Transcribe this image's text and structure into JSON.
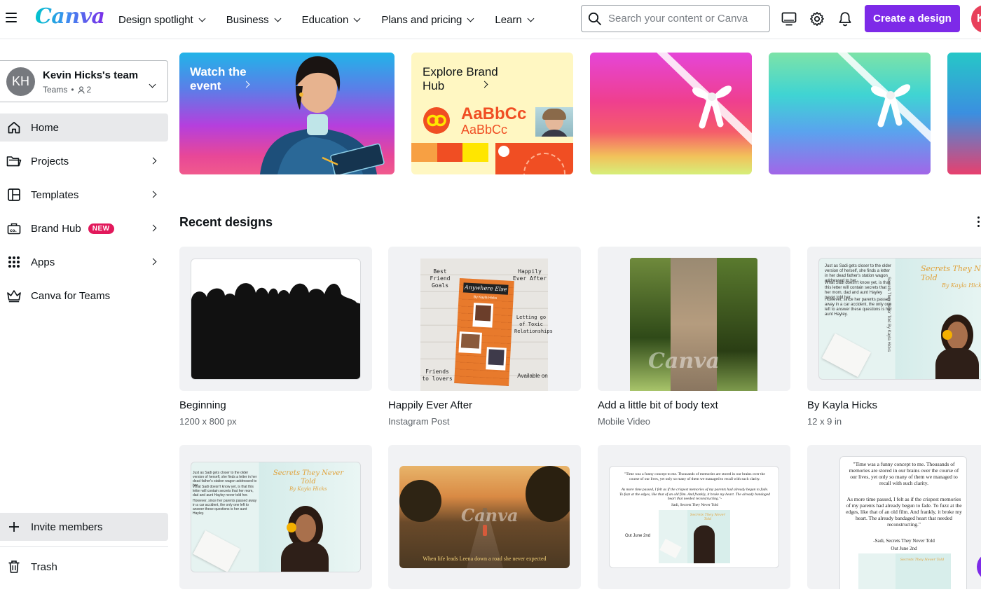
{
  "app": {
    "logo": "Canva"
  },
  "nav": [
    {
      "label": "Design spotlight"
    },
    {
      "label": "Business"
    },
    {
      "label": "Education"
    },
    {
      "label": "Plans and pricing"
    },
    {
      "label": "Learn"
    }
  ],
  "search": {
    "placeholder": "Search your content or Canva",
    "value": ""
  },
  "topbar": {
    "create_label": "Create a design",
    "avatar_initial": "K"
  },
  "team": {
    "initials": "KH",
    "name": "Kevin Hicks's team",
    "plan": "Teams",
    "members": "2"
  },
  "sidebar": {
    "items": [
      {
        "label": "Home",
        "active": true
      },
      {
        "label": "Projects"
      },
      {
        "label": "Templates"
      },
      {
        "label": "Brand Hub",
        "badge": "NEW"
      },
      {
        "label": "Apps"
      },
      {
        "label": "Canva for Teams"
      }
    ],
    "invite_label": "Invite members",
    "trash_label": "Trash"
  },
  "banners": {
    "watch": {
      "title": "Watch the event"
    },
    "brand": {
      "title": "Explore Brand Hub",
      "sample_1": "AaBbCc",
      "sample_2": "AaBbCc"
    }
  },
  "recent": {
    "title": "Recent designs",
    "designs": [
      {
        "title": "Beginning",
        "subtitle": "1200 x 800 px"
      },
      {
        "title": "Happily Ever After",
        "subtitle": "Instagram Post",
        "notes": {
          "top_left": "Best Friend Goals",
          "top_right": "Happily Ever After",
          "mid_right": "Letting go of Toxic Relationships",
          "bottom_left": "Friends to lovers",
          "bottom_right": "Available on",
          "sign": "Anywhere Else",
          "byline": "By Kayla Hicks"
        }
      },
      {
        "title": "Add a little bit of body text",
        "subtitle": "Mobile Video",
        "watermark": "Canva"
      },
      {
        "title": "By Kayla Hicks",
        "subtitle": "12 x 9 in",
        "book_title": "Secrets They Never Told",
        "book_author": "By Kayla Hicks",
        "spine": "Secrets They Never Told By Kayla Hicks",
        "blurb_1": "Just as Sadi gets closer to the older version of herself, she finds a letter in her dead father's station wagon addressed to her.",
        "blurb_2": "What Sadi doesn't know yet, is that this letter will contain secrets that her mom, dad and aunt Hayley never told her.",
        "blurb_3": "However, since her parents passed away in a car accident, the only one left to answer these questions is her aunt Hayley."
      },
      {
        "book_title": "Secrets They Never Told",
        "book_author": "By Kayla Hicks",
        "blurb_1": "Just as Sadi gets closer to the older version of herself, she finds a letter in her dead father's station wagon addressed to her.",
        "blurb_2": "What Sadi doesn't know yet, is that this letter will contain secrets that her mom, dad and aunt Hayley never told her.",
        "blurb_3": "However, since her parents passed away in a car accident, the only one left to answer these questions is her aunt Hayley."
      },
      {
        "caption": "When life leads Leena down a road she never expected",
        "watermark": "Canva"
      },
      {
        "quote_1": "\"Time was a funny concept to me. Thousands of memories are stored in our brains over the course of our lives, yet only so many of them we managed to recall with such clarity.",
        "quote_2": "As more time passed, I felt as if the crispest memories of my parents had already begun to fade. To fuzz at the edges, like that of an old film. And frankly, it broke my heart. The already bandaged heart that needed reconstructing.\"-",
        "quote_author": "Sadi, Secrets They Never Told",
        "release": "Out June 2nd",
        "book_title": "Secrets They Never Told"
      },
      {
        "quote_1": "\"Time was a funny concept to me. Thousands of memories are stored in our brains over the course of our lives, yet only so many of them we managed to recall with such clarity.",
        "quote_2": "As more time passed, I felt as if the crispest memories of my parents had already begun to fade. To fuzz at the edges, like that of an old film. And frankly, it broke my heart. The already bandaged heart that needed reconstructing.\"",
        "quote_author": "-Sadi, Secrets They Never Told",
        "release": "Out June 2nd",
        "book_title": "Secrets They Never Told"
      }
    ]
  },
  "colors": {
    "brand_purple": "#7d2ae8",
    "badge_pink": "#e2185b",
    "active_bg": "#e8e9eb"
  }
}
